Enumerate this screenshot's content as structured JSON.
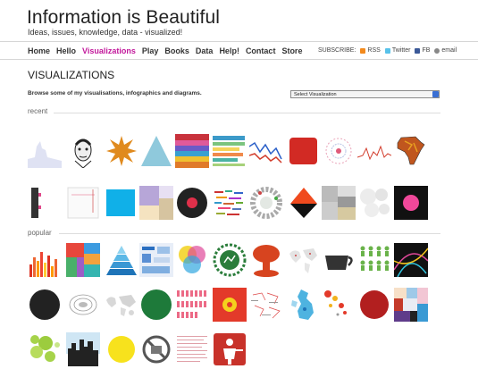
{
  "header": {
    "title": "Information is Beautiful",
    "tagline": "Ideas, issues, knowledge, data - visualized!"
  },
  "nav": {
    "items": [
      "Home",
      "Hello",
      "Visualizations",
      "Play",
      "Books",
      "Data",
      "Help!",
      "Contact",
      "Store"
    ],
    "active": "Visualizations"
  },
  "subscribe": {
    "label": "SUBSCRIBE:",
    "rss": "RSS",
    "twitter": "Twitter",
    "facebook": "FB",
    "email": "email"
  },
  "main": {
    "heading": "VISUALIZATIONS",
    "browse_text": "Browse some of my visualisations, infographics and diagrams.",
    "select_value": "Select Visualization"
  },
  "sections": {
    "recent": "recent",
    "popular": "popular"
  },
  "colors": {
    "accent": "#c2189b"
  }
}
